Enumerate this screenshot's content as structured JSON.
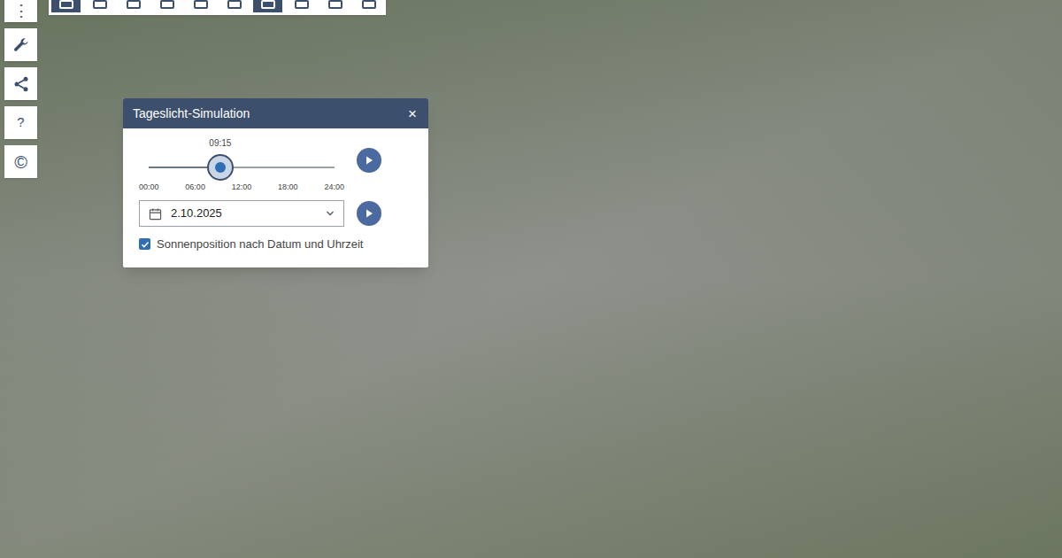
{
  "toolbar": {
    "items": [
      {
        "selected": true
      },
      {
        "selected": false
      },
      {
        "selected": false
      },
      {
        "selected": false
      },
      {
        "selected": false
      },
      {
        "selected": false
      },
      {
        "selected": true
      },
      {
        "selected": false
      },
      {
        "selected": false
      },
      {
        "selected": false
      }
    ]
  },
  "side_toolbar": {
    "menu": "⋮",
    "help": "?",
    "copyright": "©"
  },
  "dialog": {
    "title": "Tageslicht-Simulation",
    "close": "×",
    "time": {
      "reading": "09:15",
      "level": 0.385,
      "ticks": [
        "00:00",
        "06:00",
        "12:00",
        "18:00",
        "24:00"
      ]
    },
    "date": {
      "value": "2.10.2025"
    },
    "sun_position": {
      "label": "Sonnenposition nach Datum und Uhrzeit",
      "checked": true
    }
  }
}
